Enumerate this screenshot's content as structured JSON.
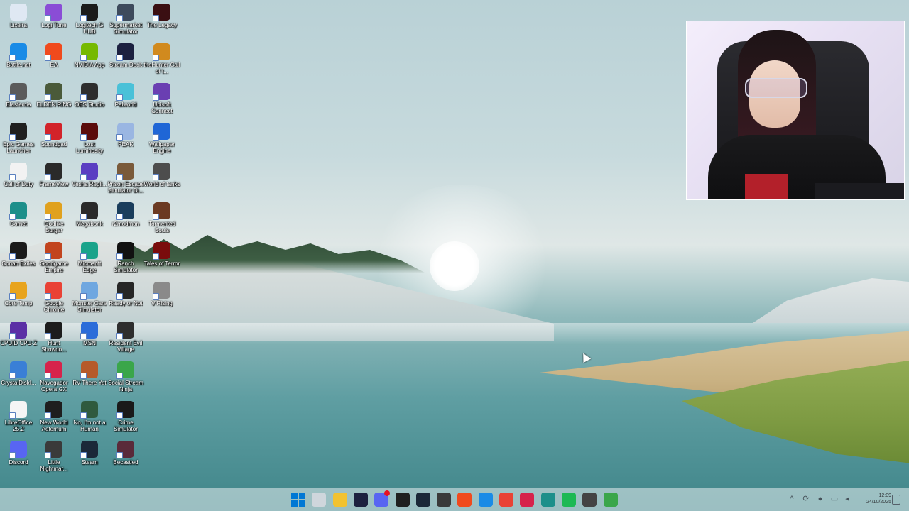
{
  "desktop": {
    "icons": [
      {
        "label": "Lixeira",
        "color": "#dfe8f3"
      },
      {
        "label": "Logi Tune",
        "color": "#8a4dd6"
      },
      {
        "label": "Logitech G HUB",
        "color": "#1b1b1b"
      },
      {
        "label": "Supermarket Simulator",
        "color": "#3d4a5c"
      },
      {
        "label": "The Legacy",
        "color": "#3a0f12"
      },
      {
        "label": "Battle.net",
        "color": "#1a8be6"
      },
      {
        "label": "EA",
        "color": "#f04a1d"
      },
      {
        "label": "NVIDIA App",
        "color": "#76b900"
      },
      {
        "label": "Stream Deck",
        "color": "#1c2140"
      },
      {
        "label": "theHunter Call of t...",
        "color": "#d18a1e"
      },
      {
        "label": "Blasfemia",
        "color": "#5b5b5b"
      },
      {
        "label": "ELDEN RING",
        "color": "#4a5a3a"
      },
      {
        "label": "OBS Studio",
        "color": "#2e2e2e"
      },
      {
        "label": "Palworld",
        "color": "#4ac1d8"
      },
      {
        "label": "Ubisoft Connect",
        "color": "#6a3fb2"
      },
      {
        "label": "Epic Games Launcher",
        "color": "#202020"
      },
      {
        "label": "Soundpad",
        "color": "#d2232a"
      },
      {
        "label": "Lost Luminosity",
        "color": "#5b0b0b"
      },
      {
        "label": "PEAK",
        "color": "#9ab6e2"
      },
      {
        "label": "Wallpaper Engine",
        "color": "#1f66d6"
      },
      {
        "label": "Call of Duty",
        "color": "#f2f2f2"
      },
      {
        "label": "FrameView",
        "color": "#2a2a2a"
      },
      {
        "label": "Vesha Repli...",
        "color": "#5b3ec2"
      },
      {
        "label": "Prison Escape Simulator Di...",
        "color": "#7a5a3a"
      },
      {
        "label": "World of tanks",
        "color": "#4d4d4d"
      },
      {
        "label": "Comet",
        "color": "#1d8f8a"
      },
      {
        "label": "Godlike Burger",
        "color": "#e0a11e"
      },
      {
        "label": "Megabonk",
        "color": "#2a2a2a"
      },
      {
        "label": "r2modman",
        "color": "#1a3d5c"
      },
      {
        "label": "Tormented Souls",
        "color": "#6b3a22"
      },
      {
        "label": "Conan Exiles",
        "color": "#1a1a1a"
      },
      {
        "label": "Goodgame Empire",
        "color": "#c2441e"
      },
      {
        "label": "Microsoft Edge",
        "color": "#1aa38a"
      },
      {
        "label": "Ranch Simulator",
        "color": "#111111"
      },
      {
        "label": "Tales of Terror",
        "color": "#7a0c0c"
      },
      {
        "label": "Core Temp",
        "color": "#e8a41e"
      },
      {
        "label": "Google Chrome",
        "color": "#e94235"
      },
      {
        "label": "Monster Care Simulator",
        "color": "#6fa7e0"
      },
      {
        "label": "Ready or Not",
        "color": "#262626"
      },
      {
        "label": "V Rising",
        "color": "#8a8a8a"
      },
      {
        "label": "CPUID CPU-Z",
        "color": "#5b2fa5"
      },
      {
        "label": "Hunt Showdo...",
        "color": "#1c1c1c"
      },
      {
        "label": "MSN",
        "color": "#2b6cd9"
      },
      {
        "label": "Resident Evil Village",
        "color": "#2e2e2e"
      },
      {
        "label": "CrystalDiskI...",
        "color": "#3a7fd6"
      },
      {
        "label": "Navegador Opera GX",
        "color": "#d6234b"
      },
      {
        "label": "RV There Yet",
        "color": "#b65a2a"
      },
      {
        "label": "Social Stream Ninja",
        "color": "#3aa64a"
      },
      {
        "label": "LibreOffice 25.2",
        "color": "#f5f5f5"
      },
      {
        "label": "New World Aeternum",
        "color": "#1e1e1e"
      },
      {
        "label": "No, I'm not a Human",
        "color": "#2f5a3e"
      },
      {
        "label": "Crime Simulator",
        "color": "#1a1a1a"
      },
      {
        "label": "Discord",
        "color": "#5865f2"
      },
      {
        "label": "Little Nightmar...",
        "color": "#3a3a3a"
      },
      {
        "label": "Steam",
        "color": "#1b2838"
      },
      {
        "label": "Becastled",
        "color": "#5a2a3a"
      }
    ]
  },
  "webcam": {
    "name": "webcam-overlay"
  },
  "taskbar": {
    "apps": [
      {
        "name": "start-icon",
        "color": "#0078d4"
      },
      {
        "name": "task-view-icon",
        "color": "#cfd6dc"
      },
      {
        "name": "file-explorer-icon",
        "color": "#f2c230"
      },
      {
        "name": "stream-deck-icon",
        "color": "#1c2140"
      },
      {
        "name": "discord-icon",
        "color": "#5865f2",
        "badge": "9+"
      },
      {
        "name": "epic-games-icon",
        "color": "#202020"
      },
      {
        "name": "steam-icon",
        "color": "#1b2838"
      },
      {
        "name": "obs-icon",
        "color": "#3a3a3a"
      },
      {
        "name": "ea-icon",
        "color": "#f04a1d"
      },
      {
        "name": "battlenet-icon",
        "color": "#1a8be6"
      },
      {
        "name": "chrome-icon",
        "color": "#e94235"
      },
      {
        "name": "opera-gx-icon",
        "color": "#d6234b"
      },
      {
        "name": "comet-icon",
        "color": "#1d8f8a"
      },
      {
        "name": "spotify-icon",
        "color": "#1db954"
      },
      {
        "name": "recording-icon",
        "color": "#444444"
      },
      {
        "name": "social-stream-icon",
        "color": "#3aa64a"
      }
    ],
    "tray": {
      "chevron": "^",
      "time": "12:09",
      "date": "24/10/2025"
    }
  }
}
